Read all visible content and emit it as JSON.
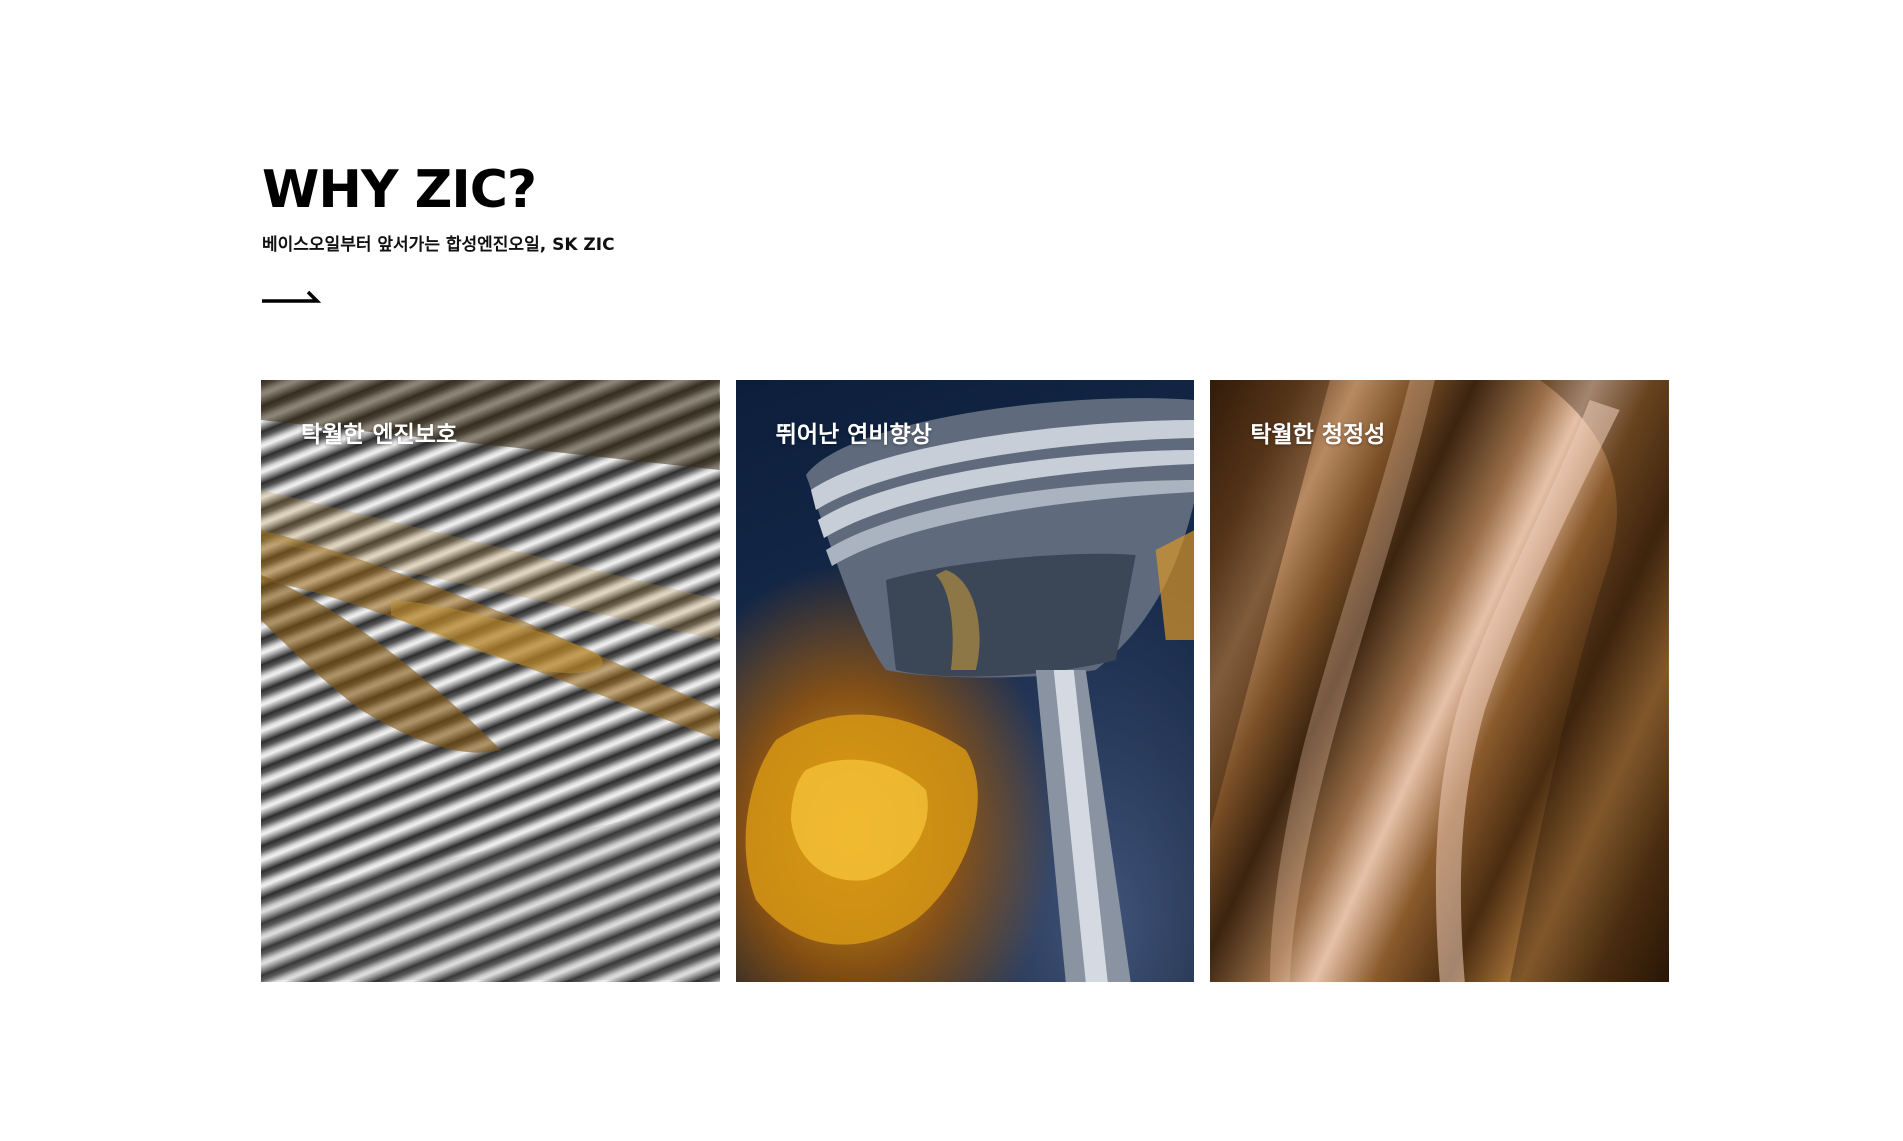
{
  "intro": {
    "title": "WHY ZIC?",
    "subtitle": "베이스오일부터 앞서가는 합성엔진오일, SK ZIC",
    "more_link_icon": "long-arrow-right-icon"
  },
  "cards": [
    {
      "label": "탁월한 엔진보호",
      "image": "engine-protection-image"
    },
    {
      "label": "뛰어난 연비향상",
      "image": "fuel-efficiency-image"
    },
    {
      "label": "탁월한 청정성",
      "image": "cleanliness-image"
    }
  ],
  "colors": {
    "text_dark": "#000000",
    "card_label": "#ffffff",
    "background": "#ffffff"
  }
}
